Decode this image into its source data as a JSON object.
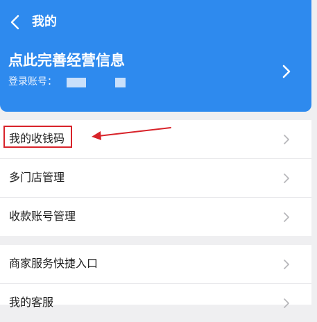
{
  "header": {
    "title": "我的",
    "profile_title": "点此完善经营信息",
    "account_label": "登录账号："
  },
  "menu_group_1": [
    {
      "label": "我的收钱码"
    },
    {
      "label": "多门店管理"
    },
    {
      "label": "收款账号管理"
    }
  ],
  "menu_group_2": [
    {
      "label": "商家服务快捷入口"
    },
    {
      "label": "我的客服"
    }
  ],
  "colors": {
    "header_blue": "#2e8aee",
    "annotation_red": "#d8232a",
    "page_background": "#efeff1"
  }
}
